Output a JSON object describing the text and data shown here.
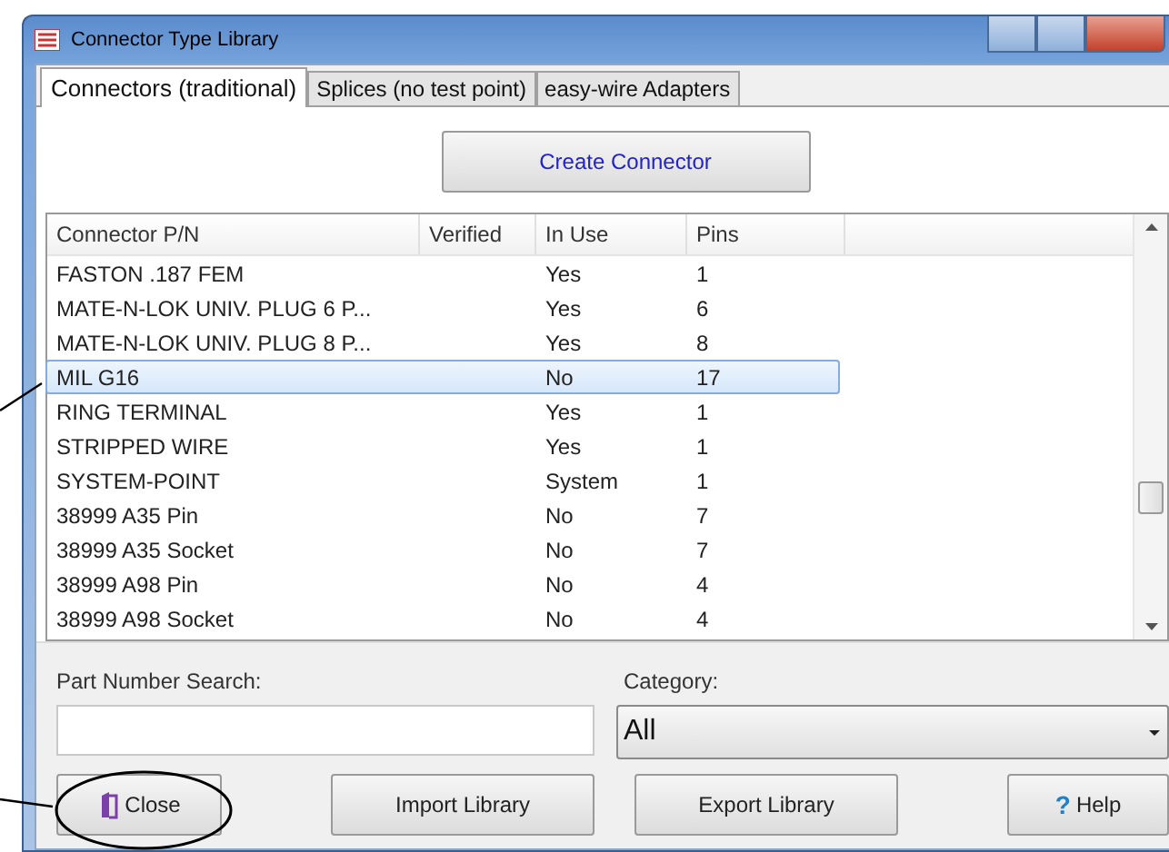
{
  "window": {
    "title": "Connector Type Library"
  },
  "tabs": [
    {
      "label": "Connectors (traditional)",
      "selected": true
    },
    {
      "label": "Splices (no test point)",
      "selected": false
    },
    {
      "label": "easy-wire Adapters",
      "selected": false
    }
  ],
  "create_button": "Create Connector",
  "table": {
    "columns": [
      "Connector P/N",
      "Verified",
      "In Use",
      "Pins"
    ],
    "rows": [
      {
        "cells": [
          "FASTON .187 FEM",
          "",
          "Yes",
          "1"
        ],
        "selected": false
      },
      {
        "cells": [
          "MATE-N-LOK UNIV. PLUG 6 P...",
          "",
          "Yes",
          "6"
        ],
        "selected": false
      },
      {
        "cells": [
          "MATE-N-LOK UNIV. PLUG 8 P...",
          "",
          "Yes",
          "8"
        ],
        "selected": false
      },
      {
        "cells": [
          "MIL G16",
          "",
          "No",
          "17"
        ],
        "selected": true
      },
      {
        "cells": [
          "RING TERMINAL",
          "",
          "Yes",
          "1"
        ],
        "selected": false
      },
      {
        "cells": [
          "STRIPPED WIRE",
          "",
          "Yes",
          "1"
        ],
        "selected": false
      },
      {
        "cells": [
          "SYSTEM-POINT",
          "",
          "System",
          "1"
        ],
        "selected": false
      },
      {
        "cells": [
          "38999 A35 Pin",
          "",
          "No",
          "7"
        ],
        "selected": false
      },
      {
        "cells": [
          "38999 A35 Socket",
          "",
          "No",
          "7"
        ],
        "selected": false
      },
      {
        "cells": [
          "38999 A98 Pin",
          "",
          "No",
          "4"
        ],
        "selected": false
      },
      {
        "cells": [
          "38999 A98 Socket",
          "",
          "No",
          "4"
        ],
        "selected": false
      }
    ]
  },
  "search": {
    "label": "Part Number Search:"
  },
  "category": {
    "label": "Category:",
    "value": "All"
  },
  "buttons": [
    {
      "kind": "close",
      "label": "Close"
    },
    {
      "kind": "plain",
      "label": "Import Library"
    },
    {
      "kind": "plain",
      "label": "Export Library"
    },
    {
      "kind": "help",
      "icon": "?",
      "label": "Help"
    }
  ]
}
